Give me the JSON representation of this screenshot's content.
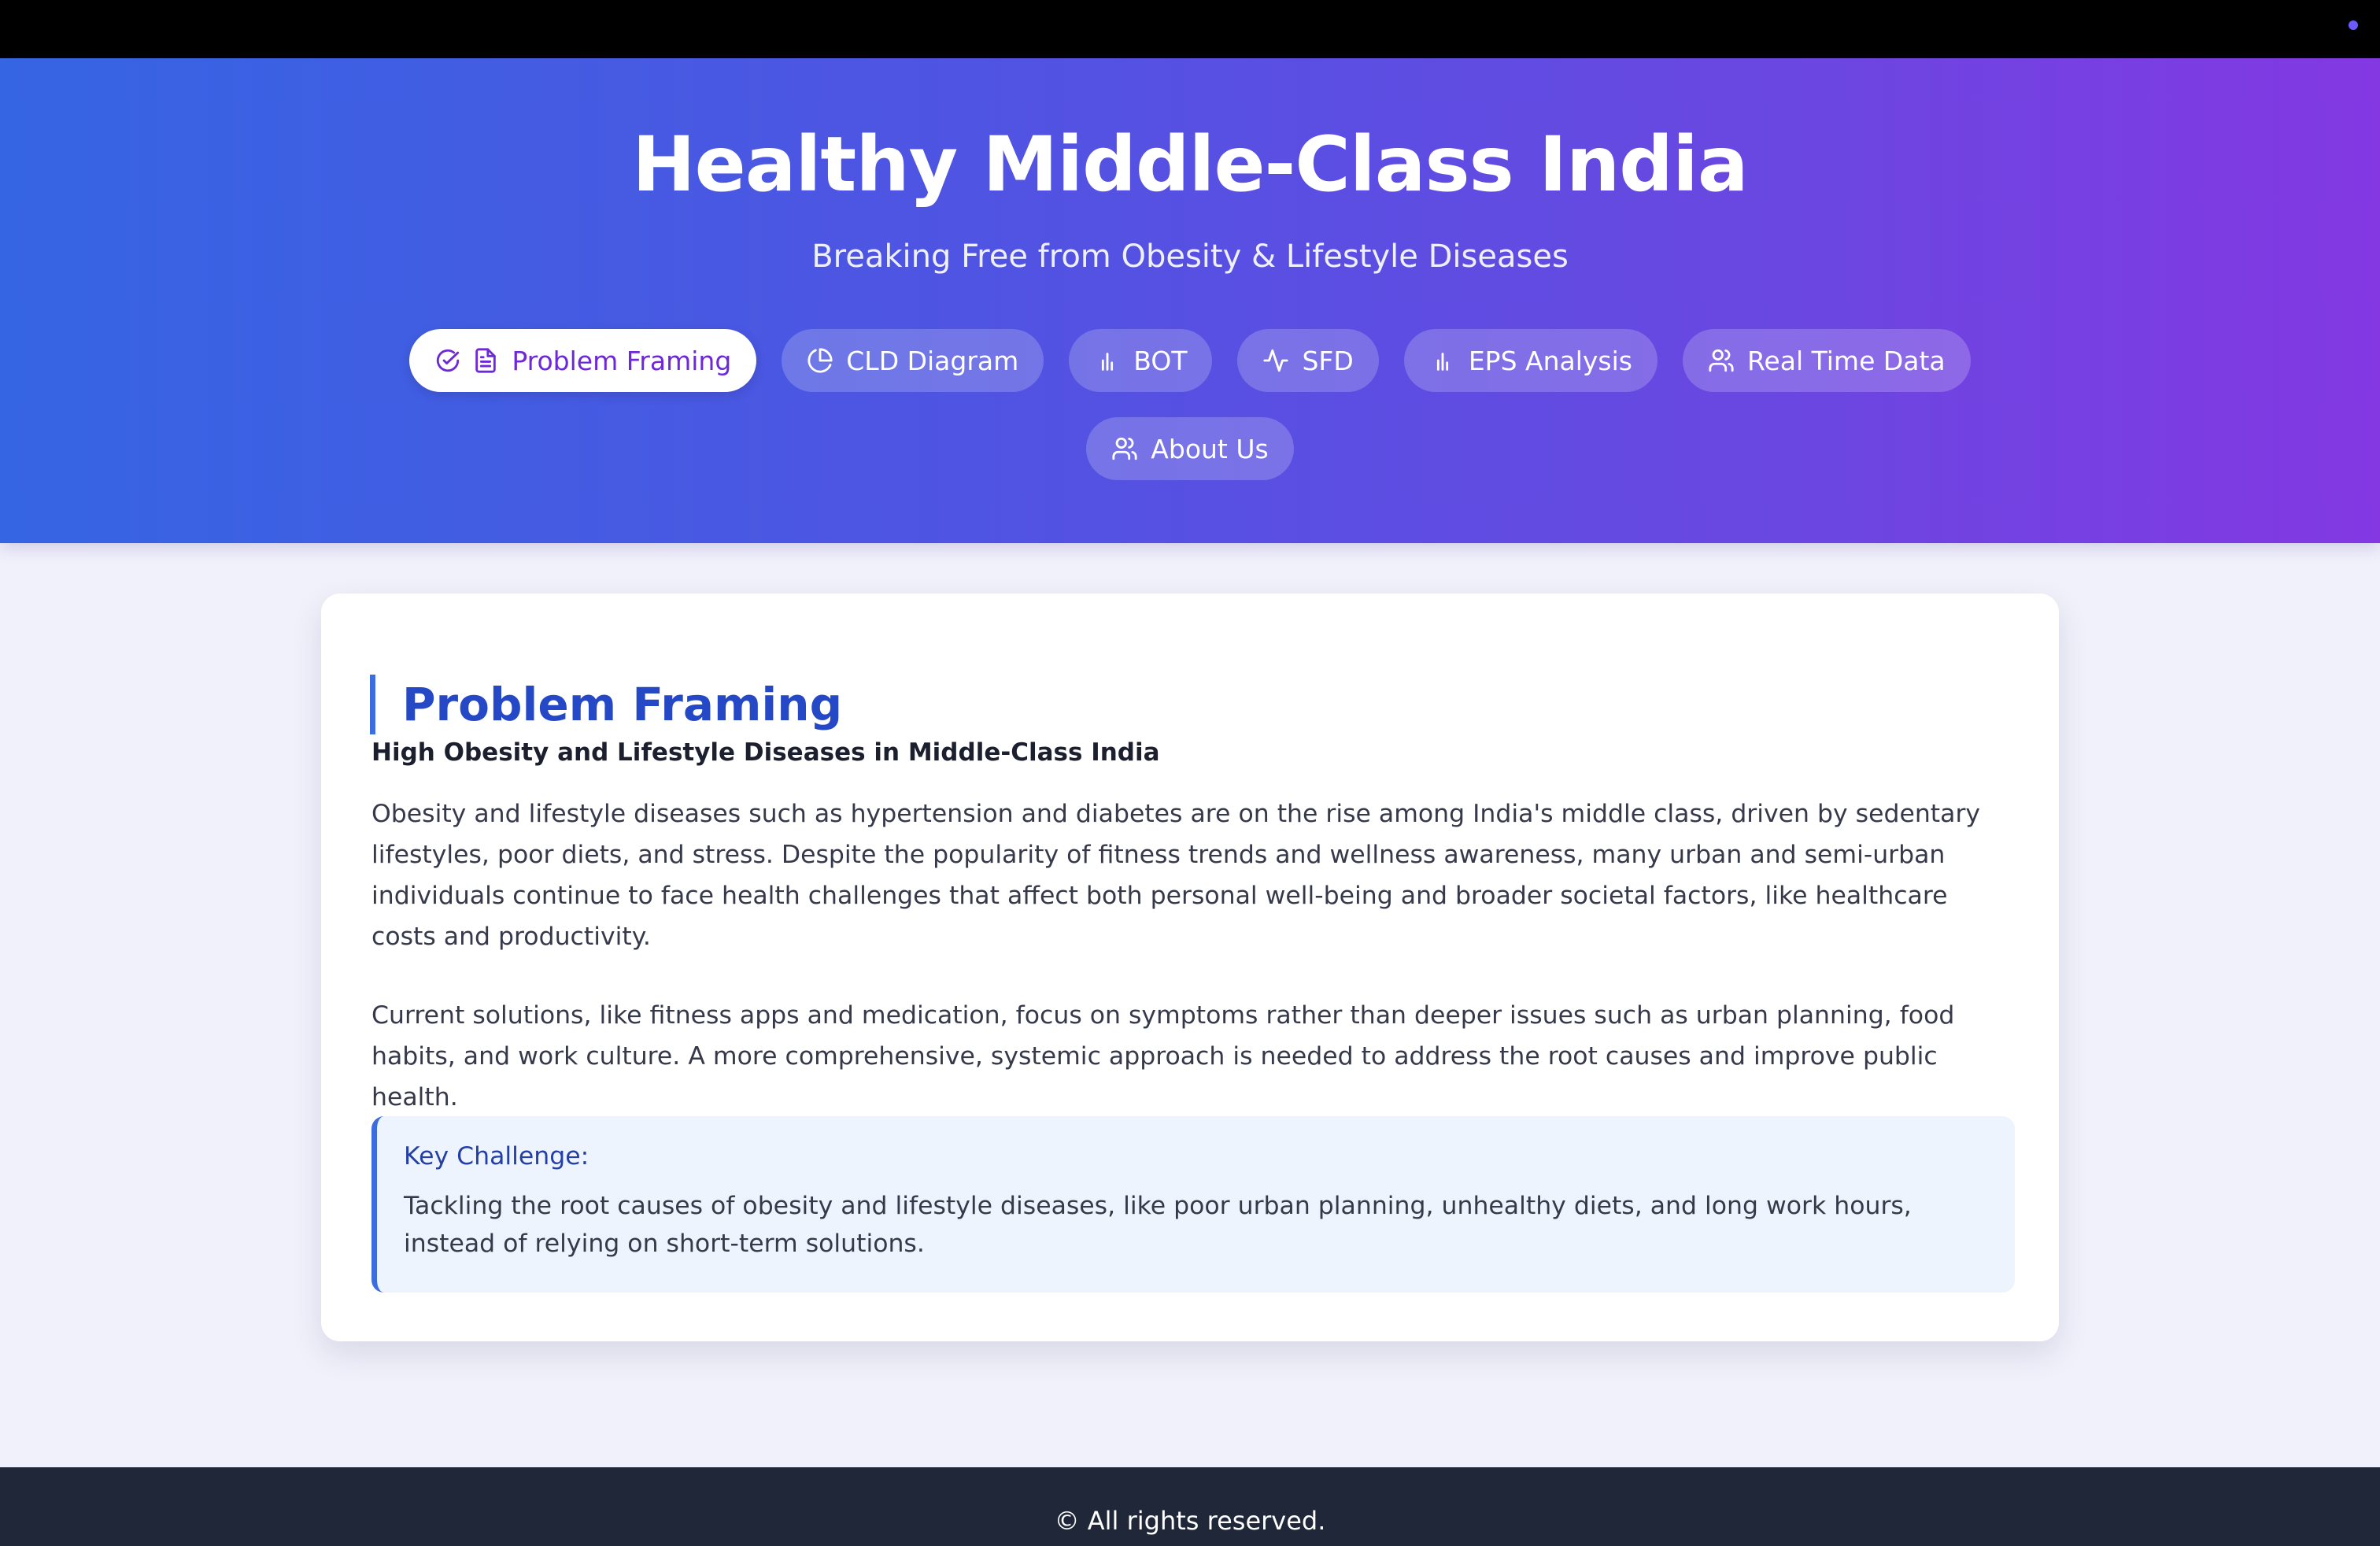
{
  "header": {
    "title": "Healthy Middle-Class India",
    "subtitle": "Breaking Free from Obesity & Lifestyle Diseases"
  },
  "nav": {
    "items": [
      {
        "label": "Problem Framing",
        "icon": "document-icon",
        "active": true
      },
      {
        "label": "CLD Diagram",
        "icon": "pie-chart-icon",
        "active": false
      },
      {
        "label": "BOT",
        "icon": "bar-chart-icon",
        "active": false
      },
      {
        "label": "SFD",
        "icon": "activity-icon",
        "active": false
      },
      {
        "label": "EPS Analysis",
        "icon": "bar-chart-icon",
        "active": false
      },
      {
        "label": "Real Time Data",
        "icon": "users-icon",
        "active": false
      },
      {
        "label": "About Us",
        "icon": "users-icon",
        "active": false
      }
    ]
  },
  "main": {
    "section_title": "Problem Framing",
    "subheading": "High Obesity and Lifestyle Diseases in Middle-Class India",
    "paragraphs": [
      "Obesity and lifestyle diseases such as hypertension and diabetes are on the rise among India's middle class, driven by sedentary lifestyles, poor diets, and stress. Despite the popularity of fitness trends and wellness awareness, many urban and semi-urban individuals continue to face health challenges that affect both personal well-being and broader societal factors, like healthcare costs and productivity.",
      "Current solutions, like fitness apps and medication, focus on symptoms rather than deeper issues such as urban planning, food habits, and work culture. A more comprehensive, systemic approach is needed to address the root causes and improve public health."
    ],
    "callout": {
      "title": "Key Challenge:",
      "text": "Tackling the root causes of obesity and lifestyle diseases, like poor urban planning, unhealthy diets, and long work hours, instead of relying on short-term solutions."
    }
  },
  "footer": {
    "text": "© All rights reserved."
  },
  "colors": {
    "gradient_start": "#3565e3",
    "gradient_end": "#8338e2",
    "accent_blue": "#2548c6",
    "active_text": "#6d28d9",
    "footer_bg": "#1f2738"
  }
}
